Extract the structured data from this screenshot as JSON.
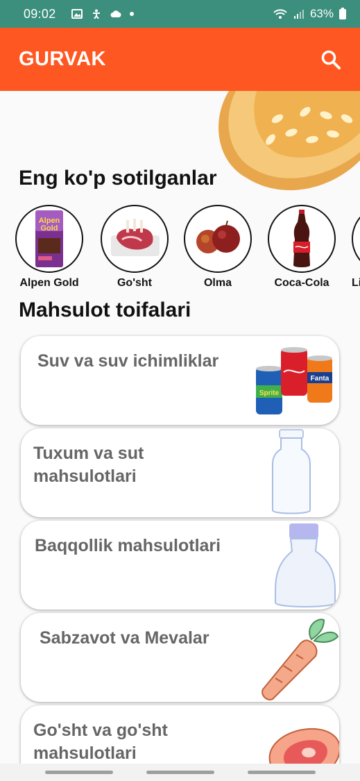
{
  "status_bar": {
    "time": "09:02",
    "battery": "63%"
  },
  "app": {
    "title": "GURVAK"
  },
  "sections": {
    "bestsellers_title": "Eng ko'p sotilganlar",
    "categories_title": "Mahsulot toifalari"
  },
  "bestsellers": [
    {
      "label": "Alpen Gold",
      "icon": "alpen-gold-chocolate-icon"
    },
    {
      "label": "Go'sht",
      "icon": "meat-icon"
    },
    {
      "label": "Olma",
      "icon": "apples-icon"
    },
    {
      "label": "Coca-Cola",
      "icon": "coca-cola-bottle-icon"
    },
    {
      "label": "Li",
      "icon": "partial-item"
    }
  ],
  "categories": [
    {
      "label": "Suv va suv ichimliklar",
      "icon": "soda-cans-icon"
    },
    {
      "label": "Tuxum va sut mahsulotlari",
      "icon": "milk-bottle-icon"
    },
    {
      "label": "Baqqollik mahsulotlari",
      "icon": "oil-bottle-icon"
    },
    {
      "label": "Sabzavot va Mevalar",
      "icon": "carrot-icon"
    },
    {
      "label": "Go'sht va go'sht mahsulotlari",
      "icon": "steak-icon"
    }
  ],
  "colors": {
    "app_bar": "#ff5722",
    "status_bar": "#3b8f7c"
  }
}
